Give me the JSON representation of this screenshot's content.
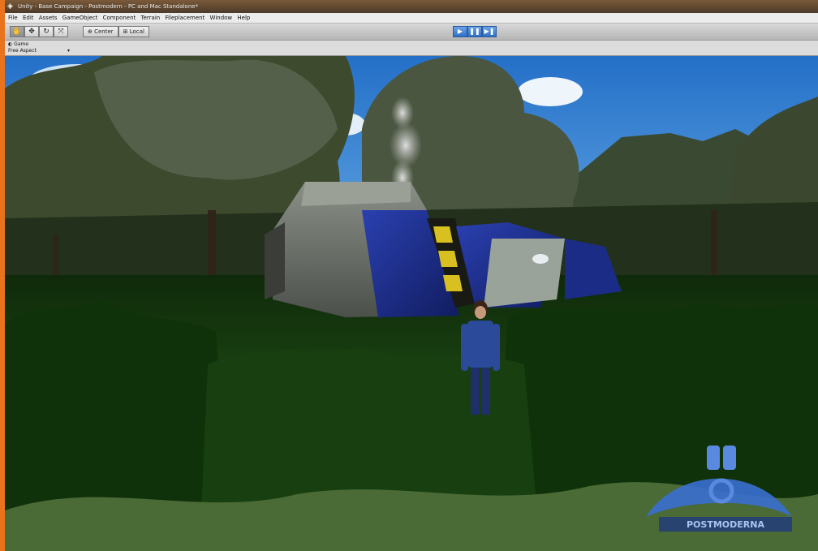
{
  "window": {
    "title": "Unity - Base Campaign - Postmodern - PC and Mac Standalone*"
  },
  "menu": [
    "File",
    "Edit",
    "Assets",
    "GameObject",
    "Component",
    "Terrain",
    "Fileplacement",
    "Window",
    "Help"
  ],
  "toolbar": {
    "tools": [
      {
        "name": "hand-tool-button",
        "glyph": "✋"
      },
      {
        "name": "move-tool-button",
        "glyph": "✥"
      },
      {
        "name": "rotate-tool-button",
        "glyph": "↻"
      },
      {
        "name": "scale-tool-button",
        "glyph": "⤧"
      }
    ],
    "pivot_label": "Center",
    "space_label": "Local",
    "play_glyph": "▶",
    "pause_glyph": "❚❚",
    "step_glyph": "▶❚"
  },
  "game_panel": {
    "tab_label": "Game",
    "aspect_value": "Free Aspect"
  },
  "colors": {
    "desktop_accent": "#e8731c",
    "play_active": "#3a7bd5",
    "sky": "#2f7fd0",
    "grass": "#1d4a14",
    "vehicle_blue": "#1c2f8a",
    "character_shirt": "#2b4a9a"
  },
  "watermark": {
    "text": "POSTMODERNA"
  }
}
